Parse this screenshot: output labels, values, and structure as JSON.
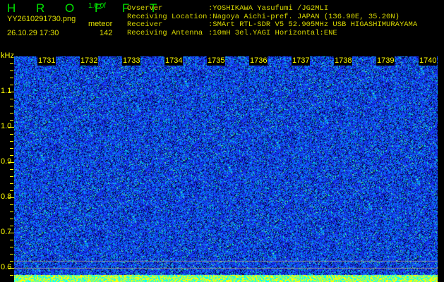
{
  "app": {
    "title": "H R O F F T",
    "version": "1.0.0f"
  },
  "file": {
    "name": "YY2610291730.png",
    "datetime": "26.10.29 17:30"
  },
  "meteor": {
    "label": "meteor",
    "count": "142"
  },
  "info": {
    "labels": [
      "Ovserver",
      "Receiving Location",
      "Receiver",
      "Receiving Antenna"
    ],
    "values": [
      ":YOSHIKAWA Yasufumi /JG2MLI",
      ":Nagoya Aichi-pref. JAPAN (136.90E, 35.20N)",
      ":SMArt RTL-SDR V5 52.905MHz USB HIGASHIMURAYAMA",
      ":10mH 3el.YAGI Horizontal:ENE"
    ]
  },
  "axis": {
    "unit": "kHz",
    "y_ticks": [
      "1.1",
      "1.0",
      "0.9",
      "0.8",
      "0.7",
      "0.6"
    ],
    "y_range": [
      0.56,
      1.2
    ]
  },
  "minutes": [
    "1731",
    "1732",
    "1733",
    "1734",
    "1735",
    "1736",
    "1737",
    "1738",
    "1739",
    "1740"
  ],
  "colors": {
    "text": "#e0e000",
    "title": "#00e000",
    "noise": "#1a3cff",
    "bar_cyan": "#00ffff",
    "bar_yellow": "#ffff00"
  }
}
